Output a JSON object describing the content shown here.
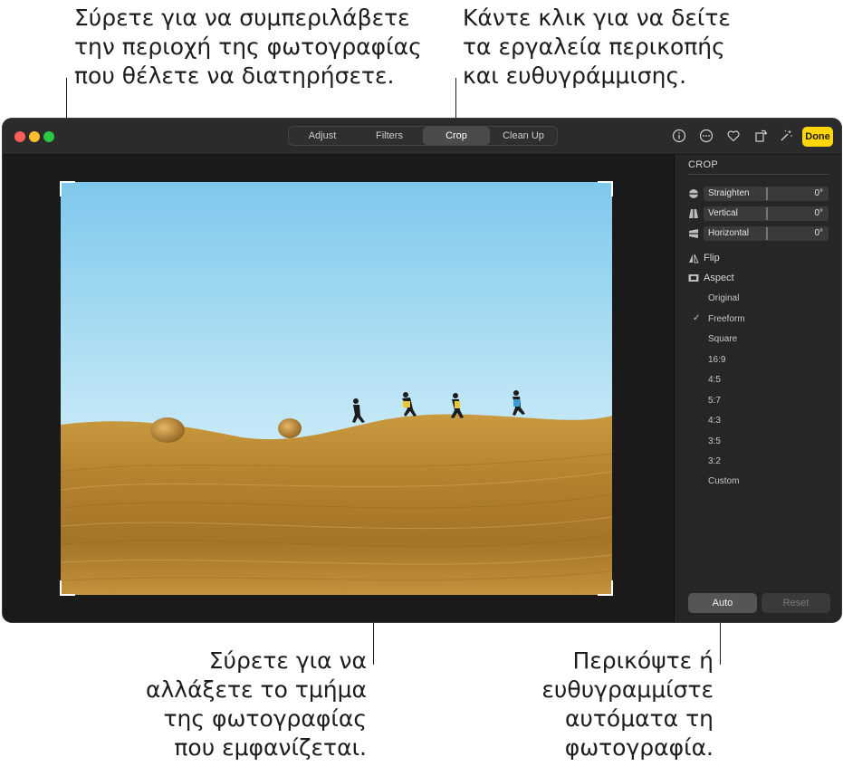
{
  "callouts": {
    "top_left": [
      "Σύρετε για να συμπεριλάβετε",
      "την περιοχή της φωτογραφίας",
      "που θέλετε να διατηρήσετε."
    ],
    "top_right": [
      "Κάντε κλικ για να δείτε",
      "τα εργαλεία περικοπής",
      "και ευθυγράμμισης."
    ],
    "bottom_left": [
      "Σύρετε για να",
      "αλλάξετε το τμήμα",
      "της φωτογραφίας",
      "που εμφανίζεται."
    ],
    "bottom_right": [
      "Περικόψτε ή",
      "ευθυγραμμίστε",
      "αυτόματα τη",
      "φωτογραφία."
    ]
  },
  "toolbar": {
    "tabs": [
      "Adjust",
      "Filters",
      "Crop",
      "Clean Up"
    ],
    "active_tab": "Crop",
    "done_label": "Done",
    "icons": [
      "info-icon",
      "more-icon",
      "heart-icon",
      "rotate-icon",
      "magic-wand-icon"
    ],
    "colors": {
      "close": "#ff5f57",
      "minimize": "#febc2e",
      "zoom": "#28c840",
      "done": "#ffd60a"
    }
  },
  "sidebar": {
    "title": "CROP",
    "sliders": [
      {
        "label": "Straighten",
        "value": "0°",
        "icon": "straighten-icon"
      },
      {
        "label": "Vertical",
        "value": "0°",
        "icon": "vertical-icon"
      },
      {
        "label": "Horizontal",
        "value": "0°",
        "icon": "horizontal-icon"
      }
    ],
    "flip_label": "Flip",
    "aspect_label": "Aspect",
    "aspect_options": [
      "Original",
      "Freeform",
      "Square",
      "16:9",
      "4:5",
      "5:7",
      "4:3",
      "3:5",
      "3:2",
      "Custom"
    ],
    "selected_aspect": "Freeform",
    "check_mark": "✓",
    "auto_label": "Auto",
    "reset_label": "Reset"
  }
}
